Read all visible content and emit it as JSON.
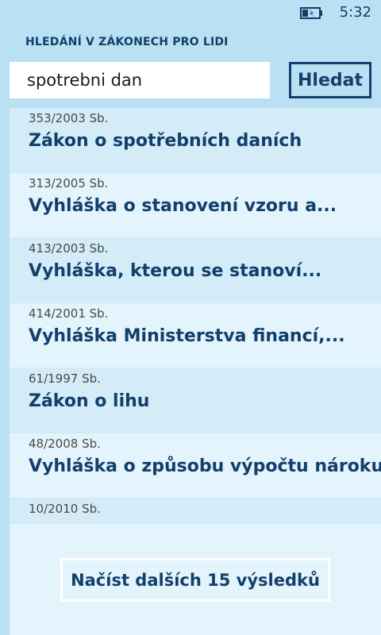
{
  "status_bar": {
    "time": "5:32",
    "battery_icon": "battery-charging-icon"
  },
  "header": {
    "title": "HLEDÁNÍ V ZÁKONECH PRO LIDI"
  },
  "search": {
    "value": "spotrebni dan",
    "button_label": "Hledat"
  },
  "results": [
    {
      "number": "353/2003 Sb.",
      "title": "Zákon o spotřebních daních"
    },
    {
      "number": "313/2005 Sb.",
      "title": "Vyhláška o stanovení vzoru a..."
    },
    {
      "number": "413/2003 Sb.",
      "title": "Vyhláška, kterou se stanoví..."
    },
    {
      "number": "414/2001 Sb.",
      "title": "Vyhláška Ministerstva financí,..."
    },
    {
      "number": "61/1997 Sb.",
      "title": "Zákon o lihu"
    },
    {
      "number": "48/2008 Sb.",
      "title": "Vyhláška o způsobu výpočtu nároku..."
    },
    {
      "number": "10/2010 Sb."
    }
  ],
  "load_more": {
    "label": "Načíst dalších 15 výsledků"
  },
  "colors": {
    "background": "#b9e0f3",
    "list_background": "#e3f4fc",
    "list_alt_background": "#d3ecf8",
    "accent": "#123f6b"
  }
}
